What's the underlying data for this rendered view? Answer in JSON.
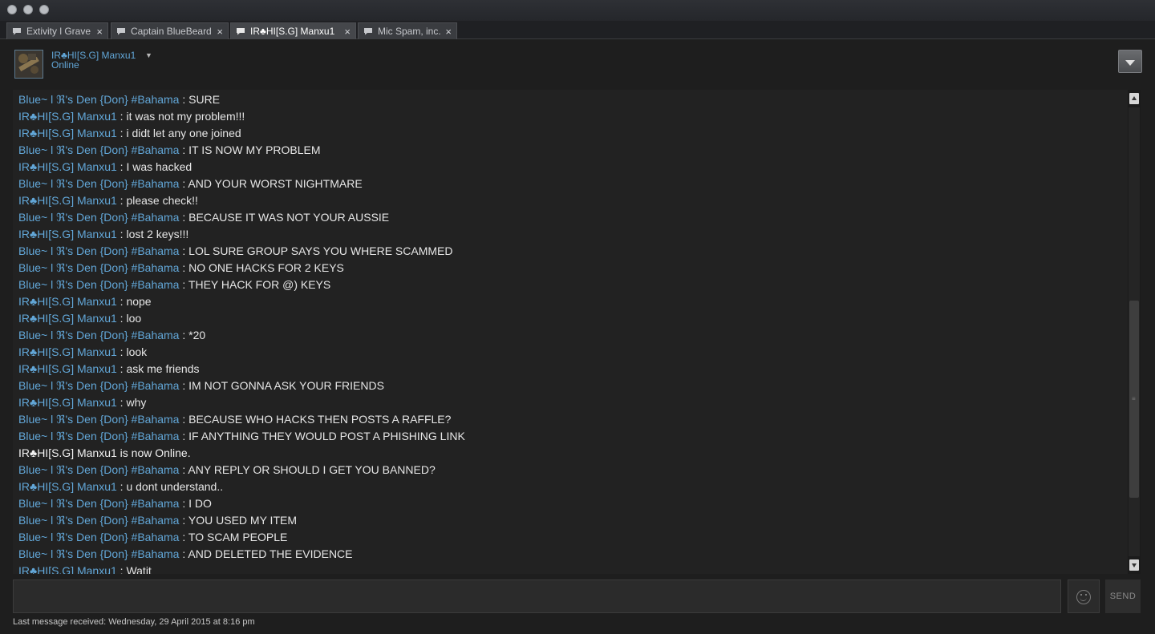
{
  "window": {
    "controls": [
      "close",
      "minimize",
      "zoom"
    ]
  },
  "tabs": [
    {
      "label": "Extivity l Grave",
      "icon": "chat-bubble-icon",
      "active": false
    },
    {
      "label": "Captain BlueBeard",
      "icon": "chat-bubble-icon",
      "active": false
    },
    {
      "label": "IR♣HI[S.G] Manxu1",
      "icon": "chat-bubble-icon",
      "active": true
    },
    {
      "label": "Mic Spam, inc.",
      "icon": "chat-bubble-icon",
      "active": false
    }
  ],
  "tab_close_glyph": "×",
  "friend": {
    "name": "IR♣HI[S.G] Manxu1",
    "status": "Online",
    "dropdown_glyph": "▼"
  },
  "colors": {
    "sender": "#62a7d8",
    "message": "#e6e6e6",
    "background": "#222222"
  },
  "messages": [
    {
      "sender": "Blue~ l ℜ's Den {Don} #Bahama",
      "text": "SURE"
    },
    {
      "sender": "IR♣HI[S.G] Manxu1",
      "text": "it was not my problem!!!"
    },
    {
      "sender": "IR♣HI[S.G] Manxu1",
      "text": "i didt let any one joined"
    },
    {
      "sender": "Blue~ l ℜ's Den {Don} #Bahama",
      "text": "IT IS NOW MY PROBLEM"
    },
    {
      "sender": "IR♣HI[S.G] Manxu1",
      "text": "I was hacked"
    },
    {
      "sender": "Blue~ l ℜ's Den {Don} #Bahama",
      "text": "AND YOUR WORST NIGHTMARE"
    },
    {
      "sender": "IR♣HI[S.G] Manxu1",
      "text": "please check!!"
    },
    {
      "sender": "Blue~ l ℜ's Den {Don} #Bahama",
      "text": "BECAUSE IT WAS NOT YOUR AUSSIE"
    },
    {
      "sender": "IR♣HI[S.G] Manxu1",
      "text": "lost 2 keys!!!"
    },
    {
      "sender": "Blue~ l ℜ's Den {Don} #Bahama",
      "text": "LOL SURE GROUP SAYS YOU  WHERE SCAMMED"
    },
    {
      "sender": "Blue~ l ℜ's Den {Don} #Bahama",
      "text": "NO ONE HACKS FOR 2 KEYS"
    },
    {
      "sender": "Blue~ l ℜ's Den {Don} #Bahama",
      "text": "THEY HACK FOR @) KEYS"
    },
    {
      "sender": "IR♣HI[S.G] Manxu1",
      "text": "nope"
    },
    {
      "sender": "IR♣HI[S.G] Manxu1",
      "text": "loo"
    },
    {
      "sender": "Blue~ l ℜ's Den {Don} #Bahama",
      "text": "*20"
    },
    {
      "sender": "IR♣HI[S.G] Manxu1",
      "text": "look"
    },
    {
      "sender": "IR♣HI[S.G] Manxu1",
      "text": "ask me friends"
    },
    {
      "sender": "Blue~ l ℜ's Den {Don} #Bahama",
      "text": "IM NOT GONNA ASK YOUR FRIENDS"
    },
    {
      "sender": "IR♣HI[S.G] Manxu1",
      "text": "why"
    },
    {
      "sender": "Blue~ l ℜ's Den {Don} #Bahama",
      "text": "BECAUSE WHO HACKS THEN POSTS A RAFFLE?"
    },
    {
      "sender": "Blue~ l ℜ's Den {Don} #Bahama",
      "text": "IF ANYTHING THEY WOULD POST A PHISHING LINK"
    },
    {
      "system": true,
      "text": "IR♣HI[S.G] Manxu1 is now Online."
    },
    {
      "sender": "Blue~ l ℜ's Den {Don} #Bahama",
      "text": "ANY REPLY OR SHOULD I GET YOU BANNED?"
    },
    {
      "sender": "IR♣HI[S.G] Manxu1",
      "text": "u dont understand.."
    },
    {
      "sender": "Blue~ l ℜ's Den {Don} #Bahama",
      "text": "I DO"
    },
    {
      "sender": "Blue~ l ℜ's Den {Don} #Bahama",
      "text": "YOU USED MY ITEM"
    },
    {
      "sender": "Blue~ l ℜ's Den {Don} #Bahama",
      "text": "TO SCAM PEOPLE"
    },
    {
      "sender": "Blue~ l ℜ's Den {Don} #Bahama",
      "text": "AND DELETED THE EVIDENCE"
    },
    {
      "sender": "IR♣HI[S.G] Manxu1",
      "text": "Watit"
    }
  ],
  "composer": {
    "value": "",
    "send_label": "SEND"
  },
  "scroll": {
    "thumb_start_fraction": 0.43,
    "thumb_size_fraction": 0.44
  },
  "footer": {
    "last_message": "Last message received: Wednesday, 29 April 2015 at 8:16 pm"
  }
}
